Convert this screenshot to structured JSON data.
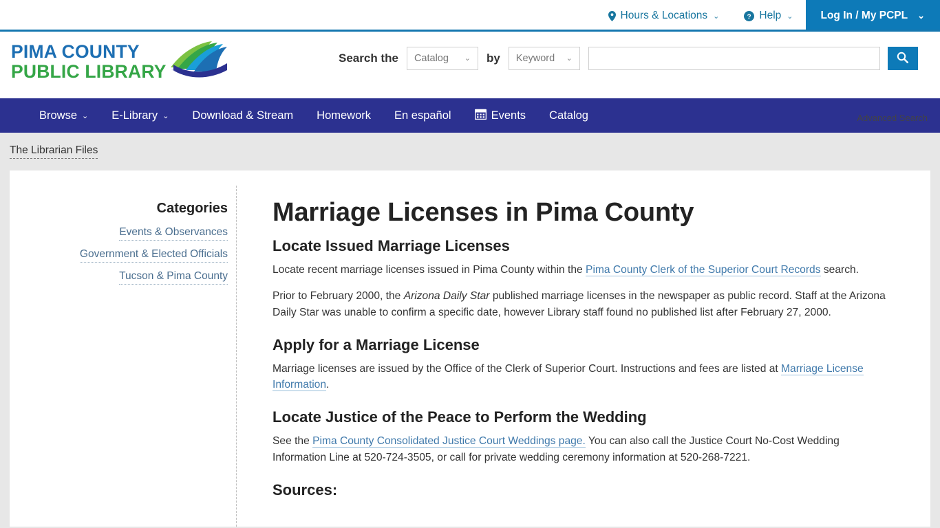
{
  "topbar": {
    "hours_locations": "Hours & Locations",
    "help": "Help",
    "login": "Log In / My PCPL",
    "caret": "⌄"
  },
  "header": {
    "logo_line1": "PIMA COUNTY",
    "logo_line2": "PUBLIC LIBRARY",
    "search_label": "Search the",
    "search_by": "by",
    "scope_value": "Catalog",
    "index_value": "Keyword",
    "search_input_value": "",
    "search_placeholder": "",
    "advanced_search": "Advanced Search",
    "caret": "⌄"
  },
  "nav": {
    "items": [
      {
        "label": "Browse",
        "caret": "⌄",
        "icon": ""
      },
      {
        "label": "E-Library",
        "caret": "⌄",
        "icon": ""
      },
      {
        "label": "Download & Stream",
        "caret": "",
        "icon": ""
      },
      {
        "label": "Homework",
        "caret": "",
        "icon": ""
      },
      {
        "label": "En español",
        "caret": "",
        "icon": ""
      },
      {
        "label": "Events",
        "caret": "",
        "icon": "calendar-icon"
      },
      {
        "label": "Catalog",
        "caret": "",
        "icon": ""
      }
    ]
  },
  "breadcrumb": {
    "label": "The Librarian Files"
  },
  "sidebar": {
    "title": "Categories",
    "categories": [
      "Events & Observances",
      "Government & Elected Officials",
      "Tucson & Pima County"
    ]
  },
  "main": {
    "page_title": "Marriage Licenses in Pima County",
    "section1_heading": "Locate Issued Marriage Licenses",
    "p1_before": "Locate recent marriage licenses issued in Pima County within the ",
    "p1_link": "Pima County Clerk of the Superior Court Records",
    "p1_after": " search.",
    "p2_before": "Prior to February 2000, the ",
    "p2_italic": "Arizona Daily Star",
    "p2_after": " published marriage licenses in the newspaper as public record. Staff at the Arizona Daily Star was unable to confirm a specific date, however Library staff found no published list after February 27, 2000.",
    "section2_heading": "Apply for a Marriage License",
    "p3_before": "Marriage licenses are issued by the Office of the Clerk of Superior Court. Instructions and fees are listed at ",
    "p3_link": "Marriage License Information",
    "p3_after": ".",
    "section3_heading": "Locate Justice of the Peace to Perform the Wedding",
    "p4_before": "See the ",
    "p4_link": "Pima County Consolidated Justice Court Weddings page.",
    "p4_after": "  You can also call the Justice Court No-Cost Wedding Information Line at 520-724-3505, or call for private wedding ceremony information at 520-268-7221.",
    "section4_heading": "Sources:"
  },
  "colors": {
    "accent_blue": "#0d7ab8",
    "nav_navy": "#2c3190",
    "rule_blue": "#1577b0",
    "logo_blue": "#1d6fb3",
    "logo_green": "#35a647",
    "link_blue": "#3f79ab",
    "page_bg": "#e7e7e7"
  }
}
